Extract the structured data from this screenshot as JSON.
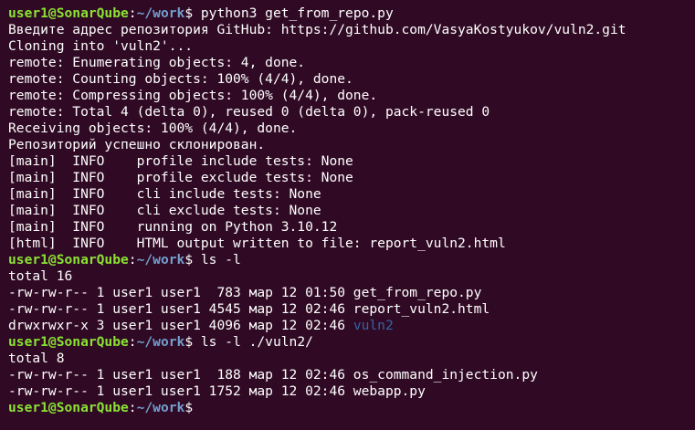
{
  "colors": {
    "background": "#300a24",
    "text": "#ffffff",
    "prompt_user": "#8ae234",
    "prompt_path": "#729fcf",
    "directory": "#3465a4"
  },
  "prompt": {
    "user": "user1@SonarQube",
    "sep": ":",
    "path": "~/work",
    "dollar": "$ "
  },
  "lines": [
    {
      "type": "prompt",
      "command": "python3 get_from_repo.py"
    },
    {
      "type": "text",
      "text": "Введите адрес репозитория GitHub: https://github.com/VasyaKostyukov/vuln2.git"
    },
    {
      "type": "text",
      "text": "Cloning into 'vuln2'..."
    },
    {
      "type": "text",
      "text": "remote: Enumerating objects: 4, done."
    },
    {
      "type": "text",
      "text": "remote: Counting objects: 100% (4/4), done."
    },
    {
      "type": "text",
      "text": "remote: Compressing objects: 100% (4/4), done."
    },
    {
      "type": "text",
      "text": "remote: Total 4 (delta 0), reused 0 (delta 0), pack-reused 0"
    },
    {
      "type": "text",
      "text": "Receiving objects: 100% (4/4), done."
    },
    {
      "type": "text",
      "text": "Репозиторий успешно склонирован."
    },
    {
      "type": "text",
      "text": "[main]  INFO    profile include tests: None"
    },
    {
      "type": "text",
      "text": "[main]  INFO    profile exclude tests: None"
    },
    {
      "type": "text",
      "text": "[main]  INFO    cli include tests: None"
    },
    {
      "type": "text",
      "text": "[main]  INFO    cli exclude tests: None"
    },
    {
      "type": "text",
      "text": "[main]  INFO    running on Python 3.10.12"
    },
    {
      "type": "text",
      "text": "[html]  INFO    HTML output written to file: report_vuln2.html"
    },
    {
      "type": "prompt",
      "command": "ls -l"
    },
    {
      "type": "text",
      "text": "total 16"
    },
    {
      "type": "text",
      "text": "-rw-rw-r-- 1 user1 user1  783 мар 12 01:50 get_from_repo.py"
    },
    {
      "type": "text",
      "text": "-rw-rw-r-- 1 user1 user1 4545 мар 12 02:46 report_vuln2.html"
    },
    {
      "type": "dirline",
      "text": "drwxrwxr-x 3 user1 user1 4096 мар 12 02:46 ",
      "name": "vuln2"
    },
    {
      "type": "prompt",
      "command": "ls -l ./vuln2/"
    },
    {
      "type": "text",
      "text": "total 8"
    },
    {
      "type": "text",
      "text": "-rw-rw-r-- 1 user1 user1  188 мар 12 02:46 os_command_injection.py"
    },
    {
      "type": "text",
      "text": "-rw-rw-r-- 1 user1 user1 1752 мар 12 02:46 webapp.py"
    },
    {
      "type": "prompt",
      "command": ""
    }
  ]
}
